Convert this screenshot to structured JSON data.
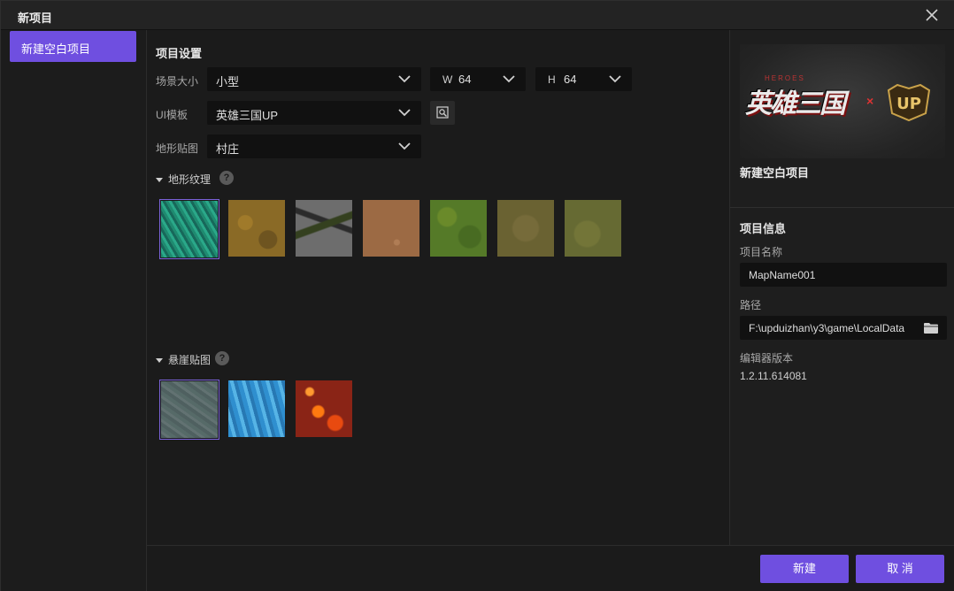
{
  "window": {
    "title": "新项目"
  },
  "sidebar": {
    "items": [
      {
        "label": "新建空白项目"
      }
    ]
  },
  "settings": {
    "title": "项目设置",
    "scene_size": {
      "label": "场景大小",
      "value": "小型"
    },
    "width": {
      "prefix": "W",
      "value": "64"
    },
    "height": {
      "prefix": "H",
      "value": "64"
    },
    "ui_template": {
      "label": "UI模板",
      "value": "英雄三国UP"
    },
    "terrain_map": {
      "label": "地形贴图",
      "value": "村庄"
    },
    "terrain_texture": {
      "label": "地形纹理",
      "help": "?"
    },
    "cliff_map": {
      "label": "悬崖贴图",
      "help": "?"
    }
  },
  "preview": {
    "logo_main": "英雄三国",
    "logo_sub": "HEROES",
    "logo_x": "×",
    "logo_up": "UP",
    "project_name": "新建空白项目"
  },
  "info": {
    "title": "项目信息",
    "name_label": "项目名称",
    "name_value": "MapName001",
    "path_label": "路径",
    "path_value": "F:\\upduizhan\\y3\\game\\LocalData",
    "version_label": "编辑器版本",
    "version_value": "1.2.11.614081"
  },
  "footer": {
    "create_label": "新建",
    "cancel_label": "取 消"
  },
  "icons": {
    "close": "close-icon",
    "chevron": "chevron-down-icon",
    "preview": "preview-icon",
    "folder": "folder-icon",
    "help": "help-icon"
  },
  "colors": {
    "accent": "#6f4fe0",
    "background": "#1b1b1b",
    "field": "#111111"
  }
}
